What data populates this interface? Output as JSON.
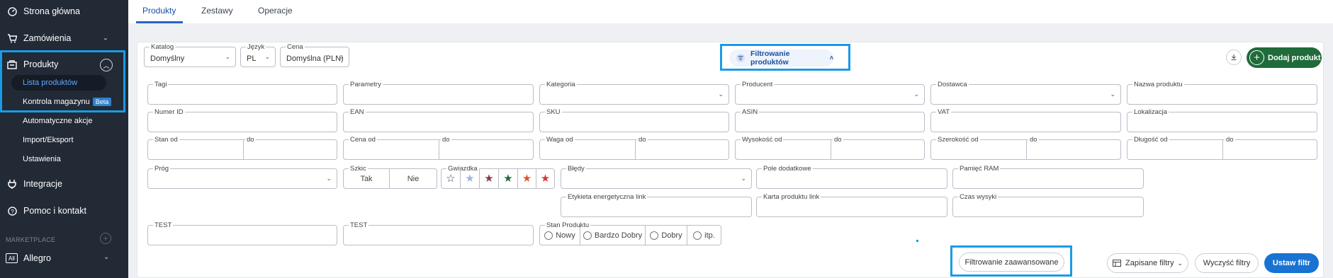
{
  "sidebar": {
    "home": "Strona główna",
    "orders": "Zamówienia",
    "products": "Produkty",
    "product_list": "Lista produktów",
    "warehouse": "Kontrola magazynu",
    "beta": "Beta",
    "auto_actions": "Automatyczne akcje",
    "import_export": "Import/Eksport",
    "settings": "Ustawienia",
    "integrations": "Integracje",
    "help": "Pomoc i kontakt",
    "marketplace": "MARKETPLACE",
    "allegro": "Allegro",
    "all_badge": "All"
  },
  "tabs": [
    "Produkty",
    "Zestawy",
    "Operacje"
  ],
  "top_filters": {
    "katalog_label": "Katalog",
    "katalog_value": "Domyślny",
    "jezyk_label": "Język",
    "jezyk_value": "PL",
    "cena_label": "Cena",
    "cena_value": "Domyślna (PLN)"
  },
  "filter_toggle": "Filtrowanie produktów",
  "add_product": "Dodaj produkt",
  "row1": [
    "Tagi",
    "Parametry",
    "Kategoria",
    "Producent",
    "Dostawca",
    "Nazwa produktu"
  ],
  "row2": [
    "Numer ID",
    "EAN",
    "SKU",
    "ASIN",
    "VAT",
    "Lokalizacja"
  ],
  "row3": [
    "Stan od",
    "Cena od",
    "Waga od",
    "Wysokość od",
    "Szerokość od",
    "Długość od"
  ],
  "row3_to": "do",
  "row4": {
    "prog": "Próg",
    "szkic": "Szkic",
    "tak": "Tak",
    "nie": "Nie",
    "gwiazdka": "Gwiazdka",
    "bledy": "Błędy",
    "pole_dodatkowe": "Pole dodatkowe",
    "pamiec_ram": "Pamięć RAM",
    "etykieta": "Etykieta energetyczna link",
    "karta": "Karta produktu link",
    "czas_wysyki": "Czas wysyki"
  },
  "row5": {
    "test1": "TEST",
    "test2": "TEST",
    "stan_produktu": "Stan Produktu",
    "options": [
      "Nowy",
      "Bardzo Dobry",
      "Dobry",
      "itp."
    ]
  },
  "stars_colors": [
    "#ffffff",
    "#9ab8e0",
    "#8b3a4a",
    "#1f6b3a",
    "#e0562a",
    "#d93a3a"
  ],
  "buttons": {
    "advanced": "Filtrowanie zaawansowane",
    "saved": "Zapisane filtry",
    "clear": "Wyczyść filtry",
    "apply": "Ustaw filtr"
  }
}
